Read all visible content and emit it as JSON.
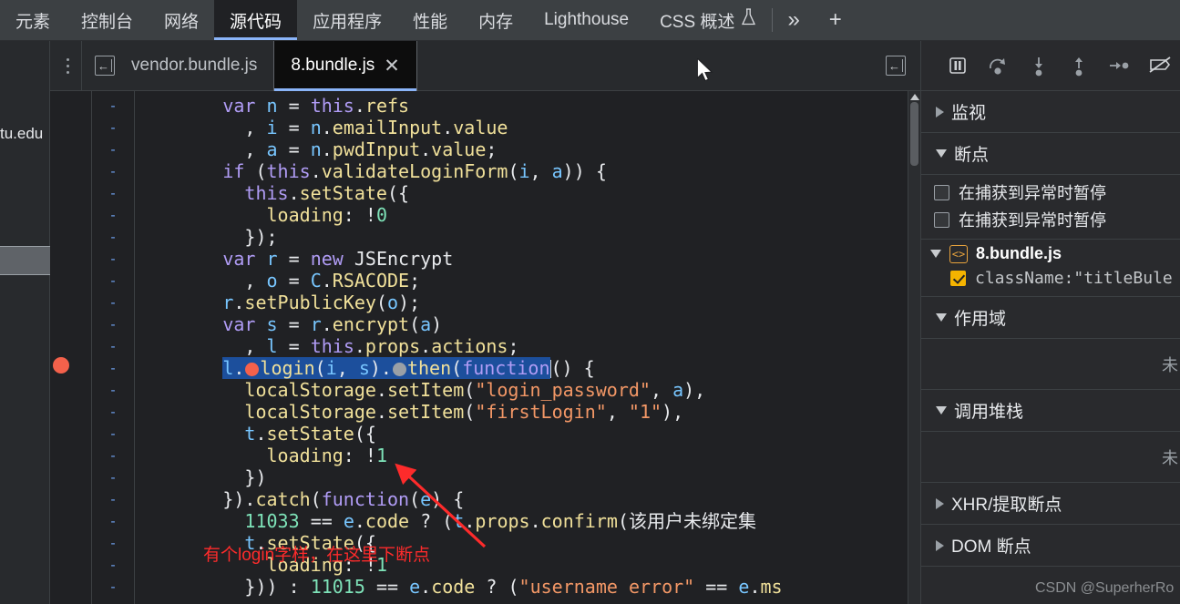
{
  "devtools": {
    "tabs": [
      {
        "label": "元素",
        "active": false
      },
      {
        "label": "控制台",
        "active": false
      },
      {
        "label": "网络",
        "active": false
      },
      {
        "label": "源代码",
        "active": true
      },
      {
        "label": "应用程序",
        "active": false
      },
      {
        "label": "性能",
        "active": false
      },
      {
        "label": "内存",
        "active": false
      },
      {
        "label": "Lighthouse",
        "active": false
      },
      {
        "label": "CSS 概述",
        "active": false,
        "icon": "flask-icon"
      }
    ],
    "more_tabs_icon": "chevron-double-right-icon",
    "add_tab_icon": "plus-icon"
  },
  "navigator": {
    "truncated_host": "tu.edu"
  },
  "editor_tabs": {
    "kebab_icon": "more-options-icon",
    "collapse_left_icon": "show-navigator-icon",
    "collapse_right_icon": "show-debugger-icon",
    "items": [
      {
        "label": "vendor.bundle.js",
        "active": false,
        "closable": false
      },
      {
        "label": "8.bundle.js",
        "active": true,
        "closable": true,
        "close_label": "✕"
      }
    ]
  },
  "editor": {
    "line_marker": "-",
    "annotation": "有个login字样，在这里下断点",
    "lines": [
      {
        "indent": 8,
        "text": "var n = this.refs"
      },
      {
        "indent": 10,
        "text": ", i = n.emailInput.value"
      },
      {
        "indent": 10,
        "text": ", a = n.pwdInput.value;"
      },
      {
        "indent": 8,
        "text": "if (this.validateLoginForm(i, a)) {"
      },
      {
        "indent": 10,
        "text": "this.setState({"
      },
      {
        "indent": 12,
        "text": "loading: !0"
      },
      {
        "indent": 10,
        "text": "});"
      },
      {
        "indent": 8,
        "text": "var r = new JSEncrypt"
      },
      {
        "indent": 10,
        "text": ", o = C.RSACODE;"
      },
      {
        "indent": 8,
        "text": "r.setPublicKey(o);"
      },
      {
        "indent": 8,
        "text": "var s = r.encrypt(a)"
      },
      {
        "indent": 10,
        "text": ", l = this.props.actions;"
      },
      {
        "indent": 8,
        "text": "l.login(i, s).then(function() {",
        "breakpoint": true,
        "selected": true
      },
      {
        "indent": 10,
        "text": "localStorage.setItem(\"login_password\", a),"
      },
      {
        "indent": 10,
        "text": "localStorage.setItem(\"firstLogin\", \"1\"),"
      },
      {
        "indent": 10,
        "text": "t.setState({"
      },
      {
        "indent": 12,
        "text": "loading: !1"
      },
      {
        "indent": 10,
        "text": "})"
      },
      {
        "indent": 8,
        "text": "}).catch(function(e) {"
      },
      {
        "indent": 10,
        "text": "11033 == e.code ? (t.props.confirm(\"该用户未绑定集"
      },
      {
        "indent": 10,
        "text": "t.setState({"
      },
      {
        "indent": 12,
        "text": "loading: !1"
      },
      {
        "indent": 10,
        "text": "})) : 11015 == e.code ? (\"username error\" == e.ms"
      }
    ]
  },
  "debugger": {
    "toolbar": [
      {
        "name": "pause-script-execution",
        "icon": "pause-icon"
      },
      {
        "name": "step-over-next-function-call",
        "icon": "step-over-icon"
      },
      {
        "name": "step-into-next-function-call",
        "icon": "step-into-icon"
      },
      {
        "name": "step-out-of-current-function",
        "icon": "step-out-icon"
      },
      {
        "name": "step",
        "icon": "step-icon"
      },
      {
        "name": "deactivate-breakpoints",
        "icon": "deactivate-breakpoints-icon"
      }
    ],
    "sections": {
      "watch": {
        "label": "监视",
        "expanded": false
      },
      "breakpoints": {
        "label": "断点",
        "expanded": true
      },
      "scope": {
        "label": "作用域",
        "expanded": true
      },
      "call_stack": {
        "label": "调用堆栈",
        "expanded": true
      },
      "xhr_breakpoints": {
        "label": "XHR/提取断点",
        "expanded": false
      },
      "dom_breakpoints": {
        "label": "DOM 断点",
        "expanded": false
      }
    },
    "pause_options": [
      {
        "label": "在捕获到异常时暂停",
        "checked": false
      },
      {
        "label": "在捕获到异常时暂停",
        "checked": false
      }
    ],
    "breakpoint_group": {
      "file": "8.bundle.js",
      "expanded": true,
      "items": [
        {
          "label": "className:\"titleBule",
          "checked": true
        }
      ]
    },
    "scope_empty_text": "未",
    "call_stack_empty_text": "未"
  },
  "watermark": "CSDN @SuperherRo"
}
